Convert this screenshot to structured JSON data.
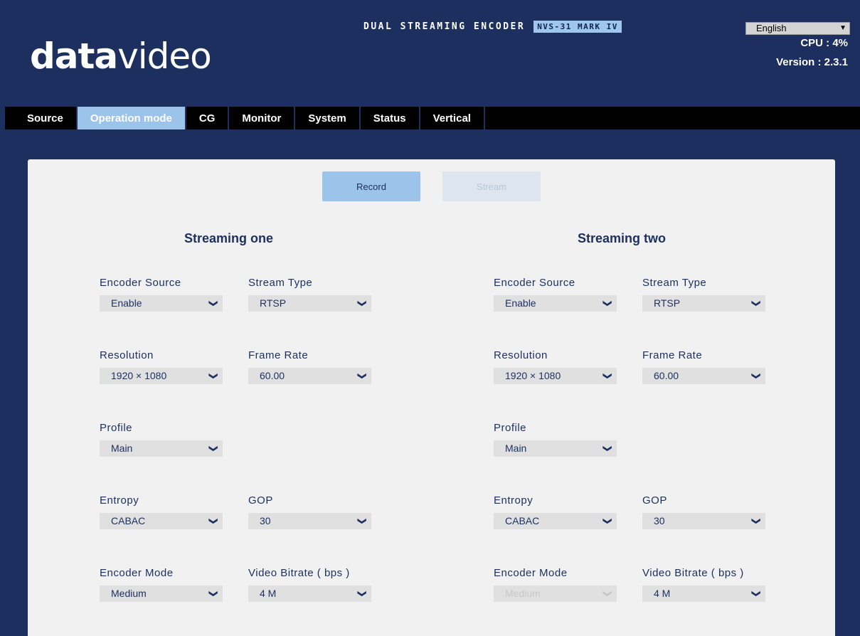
{
  "header": {
    "logo_bold": "data",
    "logo_light": "video",
    "product_title": "DUAL STREAMING ENCODER",
    "model_badge": "NVS-31 MARK IV",
    "language": "English",
    "cpu": "CPU  : 4%",
    "version": "Version : 2.3.1"
  },
  "nav": {
    "tabs": [
      "Source",
      "Operation mode",
      "CG",
      "Monitor",
      "System",
      "Status",
      "Vertical"
    ],
    "active": "Operation mode"
  },
  "mode_buttons": {
    "record": "Record",
    "stream": "Stream"
  },
  "streaming_one": {
    "title": "Streaming one",
    "encoder_source": {
      "label": "Encoder Source",
      "value": "Enable"
    },
    "stream_type": {
      "label": "Stream Type",
      "value": "RTSP"
    },
    "resolution": {
      "label": "Resolution",
      "value": "1920 × 1080"
    },
    "frame_rate": {
      "label": "Frame Rate",
      "value": "60.00"
    },
    "profile": {
      "label": "Profile",
      "value": "Main"
    },
    "entropy": {
      "label": "Entropy",
      "value": "CABAC"
    },
    "gop": {
      "label": "GOP",
      "value": "30"
    },
    "encoder_mode": {
      "label": "Encoder Mode",
      "value": "Medium"
    },
    "video_bitrate": {
      "label": "Video Bitrate ( bps )",
      "value": "4 M"
    }
  },
  "streaming_two": {
    "title": "Streaming two",
    "encoder_source": {
      "label": "Encoder Source",
      "value": "Enable"
    },
    "stream_type": {
      "label": "Stream Type",
      "value": "RTSP"
    },
    "resolution": {
      "label": "Resolution",
      "value": "1920 × 1080"
    },
    "frame_rate": {
      "label": "Frame Rate",
      "value": "60.00"
    },
    "profile": {
      "label": "Profile",
      "value": "Main"
    },
    "entropy": {
      "label": "Entropy",
      "value": "CABAC"
    },
    "gop": {
      "label": "GOP",
      "value": "30"
    },
    "encoder_mode": {
      "label": "Encoder Mode",
      "value": "Medium",
      "disabled": true
    },
    "video_bitrate": {
      "label": "Video Bitrate ( bps )",
      "value": "4 M"
    }
  },
  "colors": {
    "background": "#1c2f5f",
    "accent": "#9cc3ea",
    "panel": "#f1f1f1",
    "nav_bar": "#000000"
  },
  "icons": {
    "dropdown": "chevron-down-icon"
  }
}
